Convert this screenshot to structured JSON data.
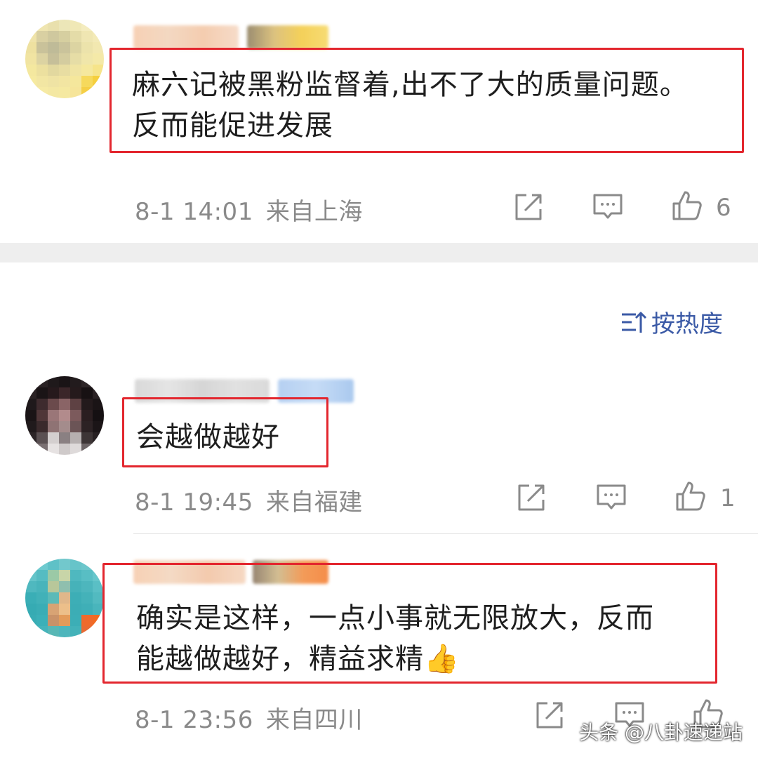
{
  "comments": [
    {
      "text_lines": [
        "麻六记被黑粉监督着,出不了大的质量问题。",
        "反而能促进发展"
      ],
      "date": "8-1 14:01",
      "location": "来自上海",
      "like_count": "6",
      "icons": [
        "share-icon",
        "comment-icon",
        "like-icon"
      ]
    },
    {
      "text_lines": [
        "会越做越好"
      ],
      "date": "8-1 19:45",
      "location": "来自福建",
      "like_count": "1",
      "icons": [
        "share-icon",
        "comment-icon",
        "like-icon"
      ]
    },
    {
      "text_lines": [
        "确实是这样，一点小事就无限放大，反而",
        "能越做越好，精益求精👍"
      ],
      "date": "8-1 23:56",
      "location": "来自四川",
      "like_count": "",
      "icons": [
        "share-icon",
        "comment-icon",
        "like-icon"
      ]
    }
  ],
  "sort": {
    "label": "按热度",
    "icon": "sort-icon"
  },
  "watermark": "头条 @八卦速递站",
  "colors": {
    "highlight_box": "#e3262e",
    "sort_link": "#3b5aa6",
    "meta_text": "#8a8a8a"
  }
}
